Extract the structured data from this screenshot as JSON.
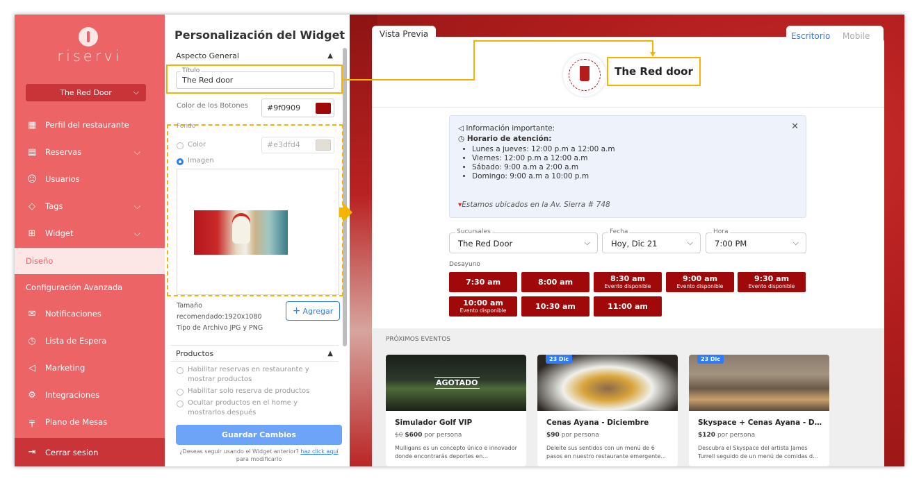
{
  "sidebar": {
    "brand": "riservi",
    "restaurant_select": "The Red Door",
    "items": [
      {
        "label": "Perfil del restaurante",
        "icon": "store-icon"
      },
      {
        "label": "Reservas",
        "icon": "reservation-icon"
      },
      {
        "label": "Usuarios",
        "icon": "user-icon"
      },
      {
        "label": "Tags",
        "icon": "tag-icon"
      },
      {
        "label": "Widget",
        "icon": "widget-icon"
      },
      {
        "label": "Diseño",
        "icon": ""
      },
      {
        "label": "Configuración Avanzada",
        "icon": ""
      },
      {
        "label": "Notificaciones",
        "icon": "mail-icon"
      },
      {
        "label": "Lista de Espera",
        "icon": "clock-icon"
      },
      {
        "label": "Marketing",
        "icon": "megaphone-icon"
      },
      {
        "label": "Integraciones",
        "icon": "integrations-icon"
      },
      {
        "label": "Plano de Mesas",
        "icon": "table-icon"
      }
    ],
    "logout": "Cerrar sesion"
  },
  "panel": {
    "title": "Personalización del Widget",
    "section_general": "Aspecto General",
    "titulo_label": "Título",
    "titulo_value": "The Red door",
    "btn_color_label": "Color de los Botones",
    "btn_color_value": "#9f0909",
    "fondo_label": "Fondo",
    "color_option": "Color",
    "color_value": "#e3dfd4",
    "image_option": "Imagen",
    "size_line1": "Tamaño",
    "size_line2": "recomendado:1920x1080",
    "file_type": "Tipo de Archivo JPG y PNG",
    "add_button": "Agregar",
    "section_products": "Productos",
    "product_opt1": "Habilitar reservas en restaurante y mostrar productos",
    "product_opt2": "Habilitar solo reserva de productos",
    "product_opt3": "Ocultar productos en el home y mostrarlos después",
    "save_button": "Guardar Cambios",
    "footer_text": "¿Deseas seguir usando el Widget anterior?",
    "footer_link": "haz click aquí",
    "footer_suffix": "para modificarlo"
  },
  "preview": {
    "tab_label": "Vista Previa",
    "mode_desktop": "Escritorio",
    "mode_mobile": "Mobile",
    "brand_title": "The Red door",
    "info": {
      "heading": "Información importante:",
      "hours_title": "Horario de atención:",
      "hours": [
        "Lunes a jueves: 12:00 p.m a 12:00 a.m",
        "Viernes: 12:00 p.m a 12:00 a.m",
        "Sábado: 9:00 a.m a 2:00 a.m",
        "Domingo: 9:00 a.m a 10:00 p.m"
      ],
      "location": "Estamos ubicados en la Av. Sierra # 748"
    },
    "selectors": {
      "sucursal_label": "Sucursales",
      "sucursal_value": "The Red Door",
      "fecha_label": "Fecha",
      "fecha_value": "Hoy, Dic 21",
      "hora_label": "Hora",
      "hora_value": "7:00 PM"
    },
    "meal_label": "Desayuno",
    "slots": [
      {
        "time": "7:30 am",
        "sub": ""
      },
      {
        "time": "8:00 am",
        "sub": ""
      },
      {
        "time": "8:30 am",
        "sub": "Evento disponible"
      },
      {
        "time": "9:00 am",
        "sub": "Evento disponible"
      },
      {
        "time": "9:30 am",
        "sub": "Evento disponible"
      },
      {
        "time": "10:00 am",
        "sub": "Evento disponible"
      },
      {
        "time": "10:30 am",
        "sub": ""
      },
      {
        "time": "11:00 am",
        "sub": ""
      }
    ],
    "events_title": "PRÓXIMOS EVENTOS",
    "events": [
      {
        "badge": "",
        "overlay": "AGOTADO",
        "name": "Simulador Golf VIP",
        "old_price": "$0",
        "price": "$600",
        "per": "por persona",
        "desc": "Mulligans es un concepto único e innovador donde encontrarás deportes en..."
      },
      {
        "badge": "23 Dic",
        "overlay": "",
        "name": "Cenas Ayana - Diciembre",
        "old_price": "",
        "price": "$90",
        "per": "por persona",
        "desc": "Deleite sus sentidos con un menú de 6 pasos  en nuestro restaurante emergente..."
      },
      {
        "badge": "23 Dic",
        "overlay": "",
        "name": "Skyspace + Cenas Ayana - Diciembre",
        "old_price": "",
        "price": "$120",
        "per": "por persona",
        "desc": "Descubra el Skyspace del artista James Turrell seguido de un menú de comidas d..."
      }
    ]
  },
  "colors": {
    "sidebar": "#ec6466",
    "button": "#9f0909",
    "accent": "#2f7df6",
    "highlight": "#f4b400"
  }
}
